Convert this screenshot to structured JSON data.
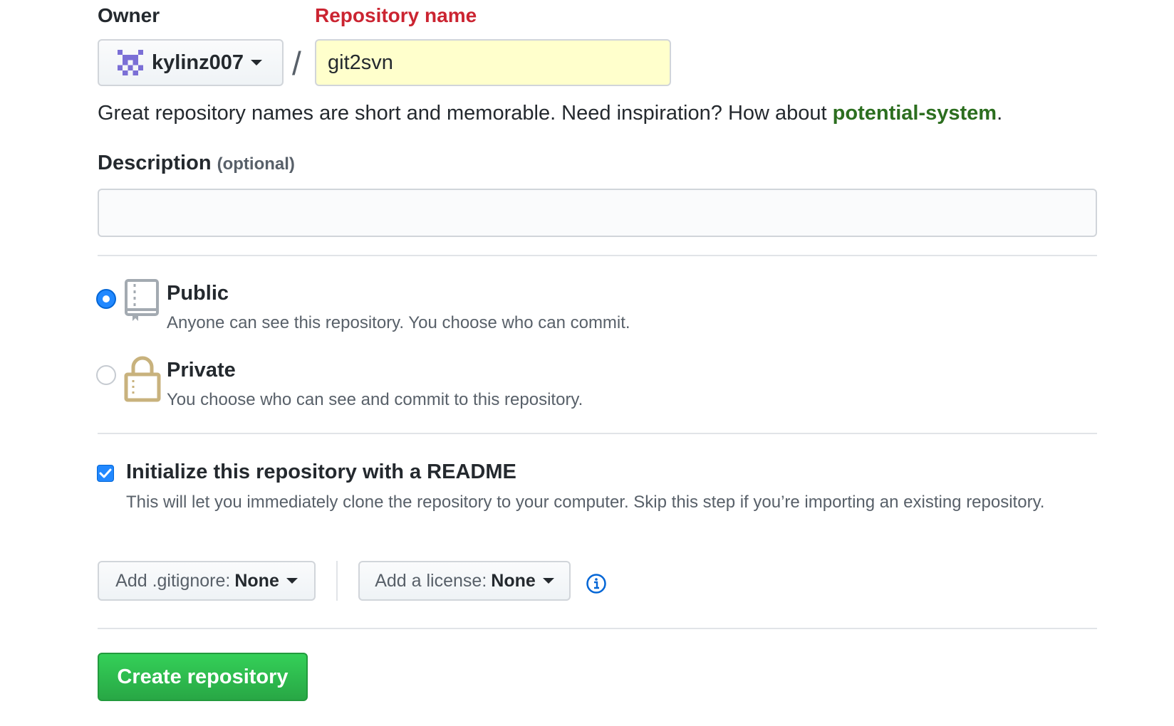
{
  "owner": {
    "label": "Owner",
    "username": "kylinz007",
    "avatar_icon": "identicon-avatar-icon",
    "avatar_color": "#7b6fd6"
  },
  "separator": "/",
  "repository": {
    "label": "Repository name",
    "value": "git2svn",
    "label_color": "#cb2431",
    "input_bg": "#ffffcc"
  },
  "hint": {
    "text": "Great repository names are short and memorable. Need inspiration? How about ",
    "suggestion": "potential-system",
    "end": "."
  },
  "description": {
    "label": "Description",
    "optional": "(optional)",
    "value": ""
  },
  "visibility": {
    "public": {
      "title": "Public",
      "subtitle": "Anyone can see this repository. You choose who can commit.",
      "icon": "repo-book-icon",
      "checked": true
    },
    "private": {
      "title": "Private",
      "subtitle": "You choose who can see and commit to this repository.",
      "icon": "lock-icon",
      "checked": false
    }
  },
  "readme": {
    "checked": true,
    "title": "Initialize this repository with a README",
    "subtitle": "This will let you immediately clone the repository to your computer. Skip this step if you’re importing an existing repository."
  },
  "gitignore": {
    "label": "Add .gitignore:",
    "value": "None"
  },
  "license": {
    "label": "Add a license:",
    "value": "None"
  },
  "info_icon": "info-icon",
  "create_button": "Create repository",
  "colors": {
    "accent_blue": "#2188ff",
    "create_green": "#28a745",
    "suggestion_green": "#2c6e1f"
  }
}
